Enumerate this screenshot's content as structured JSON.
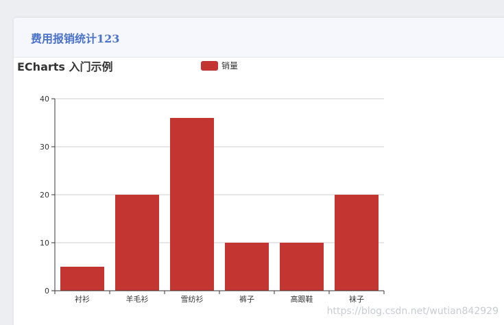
{
  "card": {
    "title": "费用报销统计123"
  },
  "chart_data": {
    "type": "bar",
    "title": "ECharts 入门示例",
    "legend": "top-center",
    "categories": [
      "衬衫",
      "羊毛衫",
      "雪纺衫",
      "裤子",
      "高跟鞋",
      "袜子"
    ],
    "series": [
      {
        "name": "销量",
        "values": [
          5,
          20,
          36,
          10,
          10,
          20
        ],
        "color": "#c23531"
      }
    ],
    "ylim": [
      0,
      40
    ],
    "yticks": [
      0,
      10,
      20,
      30,
      40
    ],
    "grid": true
  },
  "watermark": "https://blog.csdn.net/wutian842929"
}
